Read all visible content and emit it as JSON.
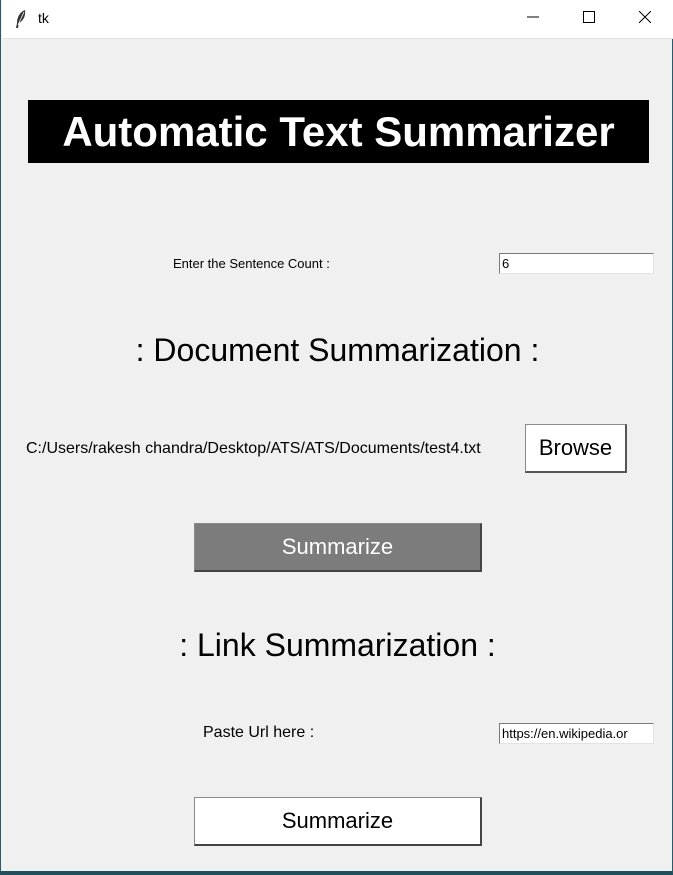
{
  "window": {
    "title": "tk",
    "controls": [
      "minimize-icon",
      "maximize-icon",
      "close-icon"
    ]
  },
  "banner": {
    "title": "Automatic Text Summarizer"
  },
  "sentence_count": {
    "label": "Enter the Sentence Count :",
    "value": "6"
  },
  "document_section": {
    "heading": ": Document Summarization :",
    "file_path": "C:/Users/rakesh chandra/Desktop/ATS/ATS/Documents/test4.txt",
    "browse_label": "Browse",
    "summarize_label": "Summarize"
  },
  "link_section": {
    "heading": ": Link Summarization :",
    "url_label": "Paste Url here :",
    "url_value": "https://en.wikipedia.or",
    "summarize_label": "Summarize"
  },
  "colors": {
    "banner_bg": "#000000",
    "banner_text": "#ffffff",
    "window_bg": "#f0f0f0",
    "doc_summarize_bg": "#7c7c7c"
  }
}
